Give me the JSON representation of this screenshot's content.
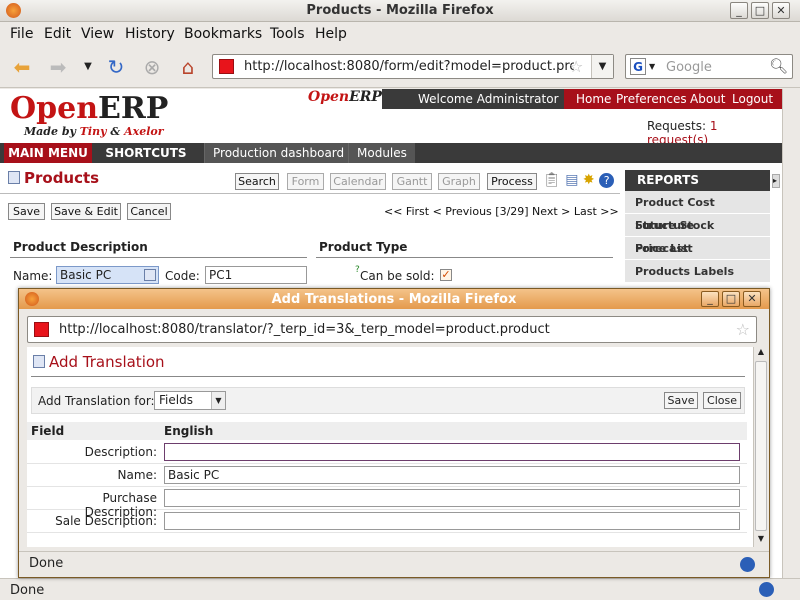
{
  "window": {
    "title": "Products - Mozilla Firefox",
    "minimize": "_",
    "maximize": "□",
    "close": "✕"
  },
  "menu": [
    "File",
    "Edit",
    "View",
    "History",
    "Bookmarks",
    "Tools",
    "Help"
  ],
  "nav": {
    "url": "http://localhost:8080/form/edit?model=product.pro",
    "search_placeholder": "Google",
    "search_engine": "G"
  },
  "header": {
    "logo_open": "Open",
    "logo_erp": "ERP",
    "logo_made_by": "Made by",
    "logo_tiny": "Tiny",
    "logo_and": "&",
    "logo_axelor": "Axelor",
    "small_logo": "OpenERP",
    "welcome": "Welcome Administrator",
    "links": [
      "Home",
      "Preferences",
      "About",
      "Logout"
    ],
    "requests_label": "Requests:",
    "requests_link": "1 request(s)"
  },
  "mainmenu": {
    "main_menu": "MAIN MENU",
    "shortcuts": "SHORTCUTS",
    "tabs": [
      "Production dashboard",
      "Modules"
    ]
  },
  "form": {
    "title": "Products",
    "view_buttons": [
      "Search",
      "Form",
      "Calendar",
      "Gantt",
      "Graph",
      "Process"
    ],
    "action_buttons": [
      "Save",
      "Save & Edit",
      "Cancel"
    ],
    "pager": "<< First < Previous [3/29] Next > Last >>",
    "section_description": "Product Description",
    "section_type": "Product Type",
    "name_label": "Name:",
    "name_value": "Basic PC",
    "code_label": "Code:",
    "code_value": "PC1",
    "can_be_sold_label": "Can be sold:",
    "can_be_sold_help": "?",
    "can_be_sold_check": "✓"
  },
  "reports": {
    "title": "REPORTS",
    "items": [
      "Product Cost Structure",
      "Future Stock Forecast",
      "Price List",
      "Products Labels"
    ]
  },
  "popup": {
    "title": "Add Translations - Mozilla Firefox",
    "url": "http://localhost:8080/translator/?_terp_id=3&_terp_model=product.product",
    "heading": "Add Translation",
    "add_for_label": "Add Translation for:",
    "add_for_value": "Fields",
    "save": "Save",
    "close": "Close",
    "col_field": "Field",
    "col_lang": "English",
    "rows": [
      {
        "label": "Description:",
        "value": ""
      },
      {
        "label": "Name:",
        "value": "Basic PC"
      },
      {
        "label": "Purchase Description:",
        "value": ""
      },
      {
        "label": "Sale Description:",
        "value": ""
      }
    ],
    "status": "Done"
  },
  "status": "Done",
  "colors": {
    "brand_red": "#a7101a",
    "dark_bar": "#3a3a3a",
    "popup_title": "#e49a4c"
  }
}
